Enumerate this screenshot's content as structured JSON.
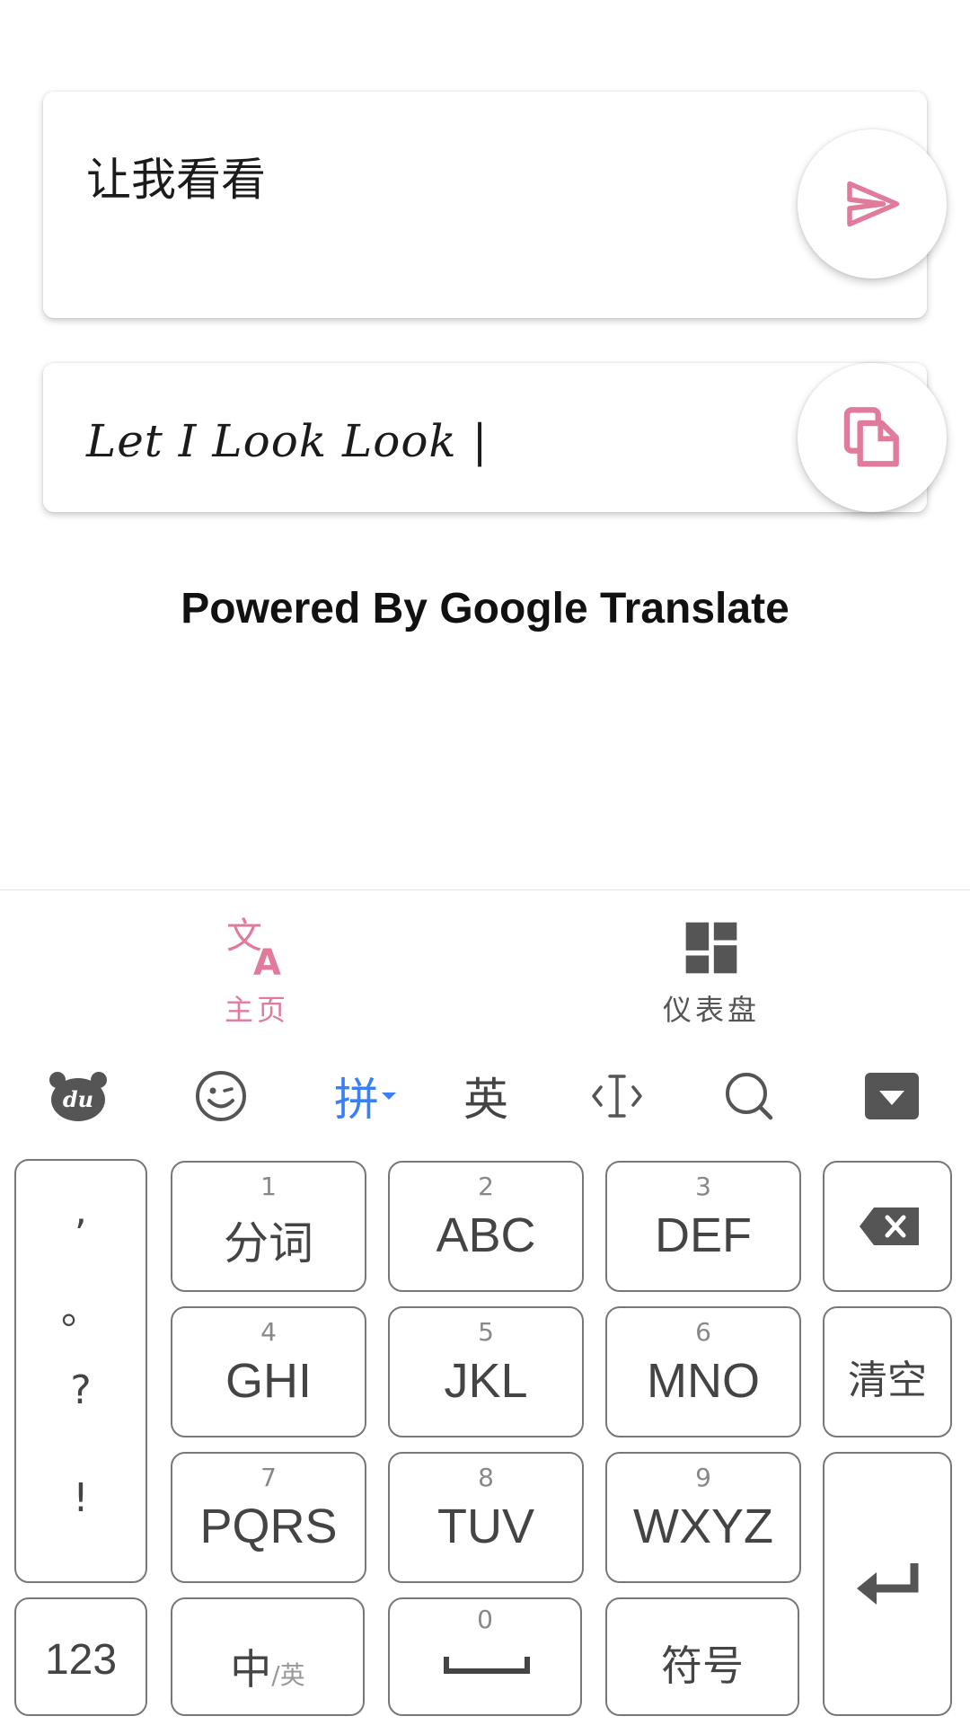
{
  "input_card": {
    "text": "让我看看"
  },
  "output_card": {
    "text": "Let I Look Look |"
  },
  "powered_by": "Powered By Google Translate",
  "bottom_nav": {
    "items": [
      {
        "label": "主页",
        "icon": "translate-icon",
        "active": true
      },
      {
        "label": "仪表盘",
        "icon": "dashboard-icon",
        "active": false
      }
    ]
  },
  "keyboard": {
    "toolbar": {
      "logo_icon": "du-bear-logo-icon",
      "emoji_icon": "emoji-wink-icon",
      "pinyin_label": "拼",
      "english_label": "英",
      "cursor_icon": "cursor-move-icon",
      "search_icon": "search-icon",
      "hide_icon": "hide-keyboard-icon"
    },
    "punctuation": [
      ",",
      "。",
      "?",
      "!"
    ],
    "keys": [
      {
        "num": "1",
        "label": "分词"
      },
      {
        "num": "2",
        "label": "ABC"
      },
      {
        "num": "3",
        "label": "DEF"
      },
      {
        "num": "4",
        "label": "GHI"
      },
      {
        "num": "5",
        "label": "JKL"
      },
      {
        "num": "6",
        "label": "MNO"
      },
      {
        "num": "7",
        "label": "PQRS"
      },
      {
        "num": "8",
        "label": "TUV"
      },
      {
        "num": "9",
        "label": "WXYZ"
      }
    ],
    "clear_label": "清空",
    "num_mode_label": "123",
    "lang_toggle": {
      "main": "中",
      "sub": "/英"
    },
    "space_num": "0",
    "symbols_label": "符号"
  },
  "colors": {
    "accent_pink": "#e07b9b",
    "pinyin_blue": "#3b7ff6",
    "icon_gray": "#555555"
  }
}
